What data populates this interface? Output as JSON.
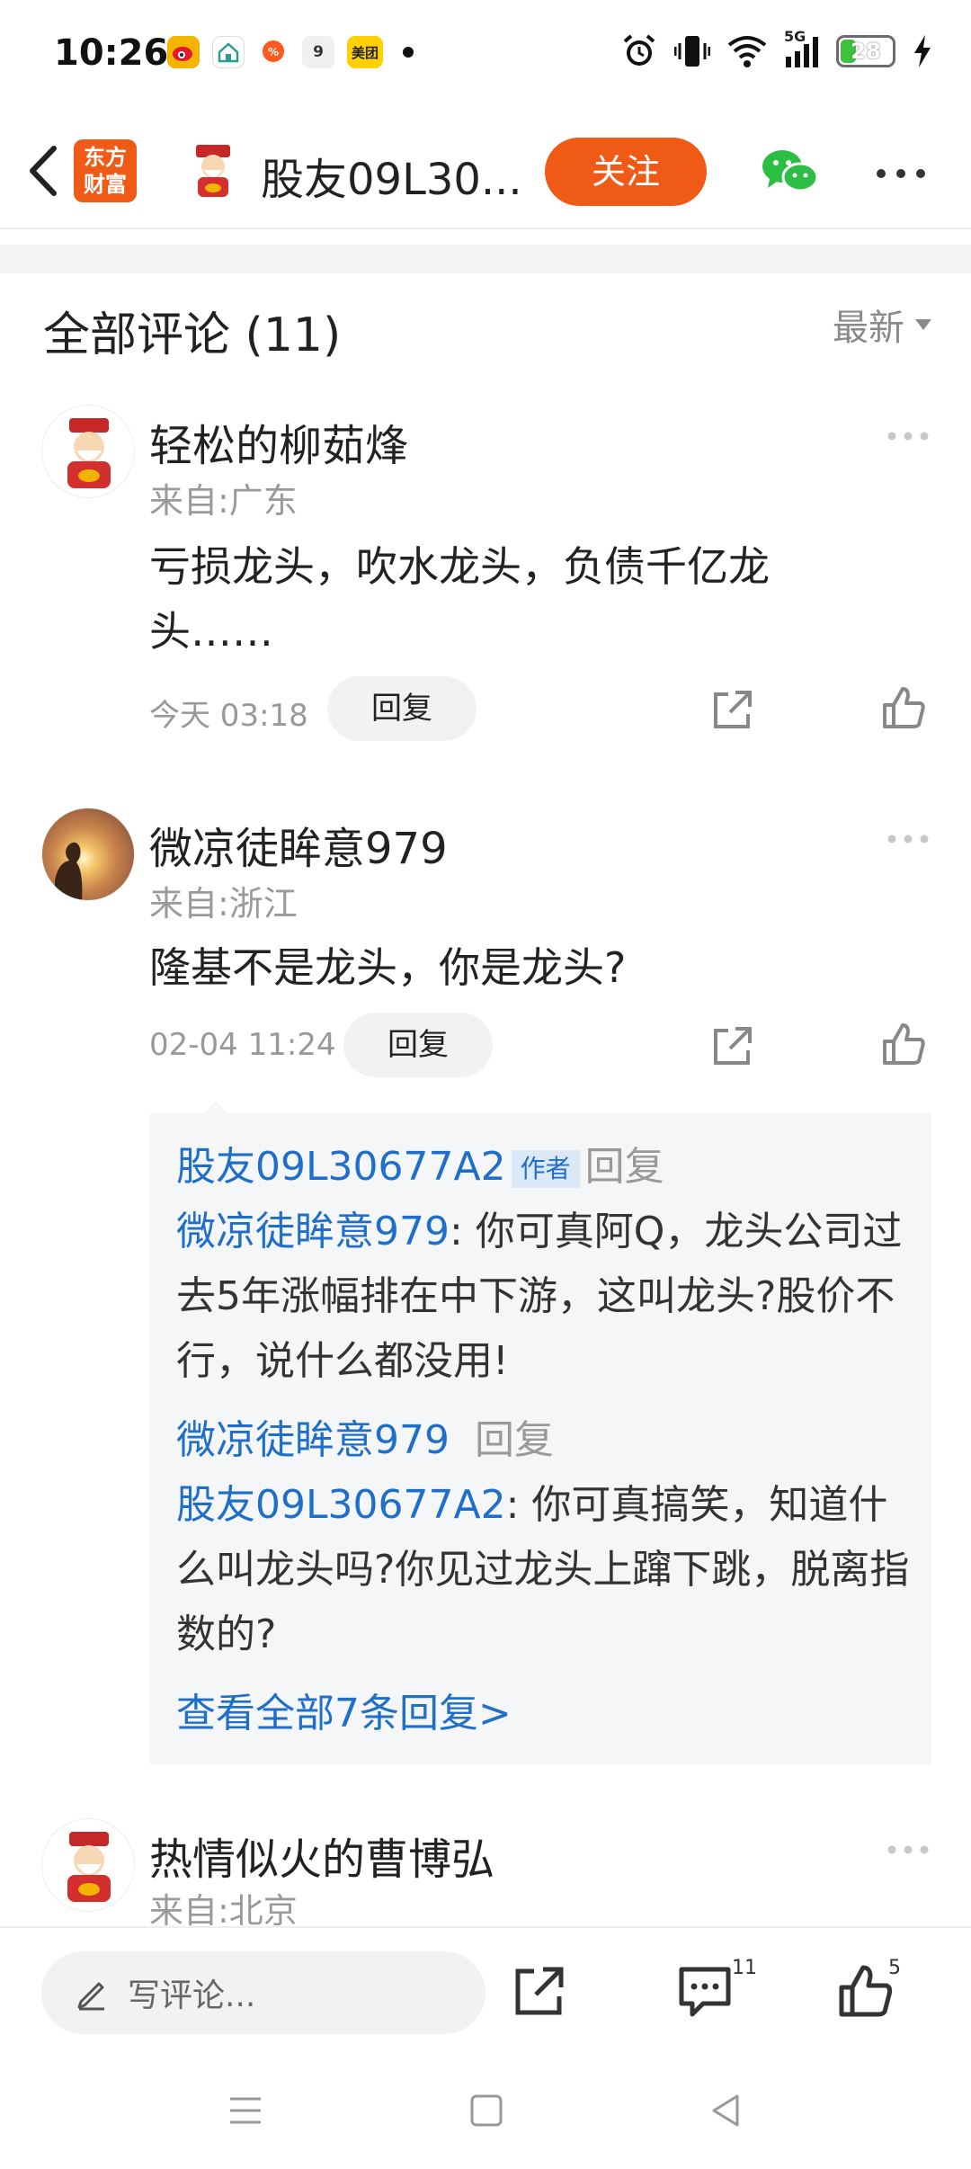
{
  "status_bar": {
    "time": "10:26",
    "apps": [
      {
        "icon": "weibo-icon",
        "label": "",
        "color": "#f4b400"
      },
      {
        "icon": "home-app-icon",
        "label": "",
        "color": "#ffffff"
      },
      {
        "icon": "taobao-deal-icon",
        "label": "",
        "color": "#ff5a1f"
      },
      {
        "icon": "nine-app-icon",
        "label": "9",
        "color": "#f0f0f0"
      },
      {
        "icon": "meituan-icon",
        "label": "美团",
        "color": "#ffd100"
      }
    ],
    "network": "5G",
    "battery": "28",
    "battery_level": 0.28
  },
  "header": {
    "brand": "东方财富",
    "title": "股友09L30...",
    "follow_label": "关注"
  },
  "comments_header": {
    "title": "全部评论 (11)",
    "sort_label": "最新"
  },
  "comments": [
    {
      "name": "轻松的柳茹烽",
      "location": "来自:广东",
      "text": "亏损龙头，吹水龙头，负债千亿龙头……",
      "time": "今天 03:18",
      "reply_label": "回复"
    },
    {
      "name": "微凉徒眸意979",
      "location": "来自:浙江",
      "text": "隆基不是龙头，你是龙头?",
      "time": "02-04 11:24",
      "reply_label": "回复",
      "replies": [
        {
          "author": "股友09L30677A2",
          "author_tag": "作者",
          "reply_word": "回复",
          "target": "微凉徒眸意979",
          "text": ": 你可真阿Q，龙头公司过去5年涨幅排在中下游，这叫龙头?股价不行，说什么都没用!"
        },
        {
          "author": "微凉徒眸意979",
          "reply_word": "回复",
          "target": "股友09L30677A2",
          "text": ": 你可真搞笑，知道什么叫龙头吗?你见过龙头上蹿下跳，脱离指数的?"
        }
      ],
      "view_all": "查看全部7条回复>"
    },
    {
      "name": "热情似火的曹博弘",
      "location": "来自:北京"
    }
  ],
  "bottom_bar": {
    "comment_placeholder": "写评论...",
    "comment_count": "11",
    "like_count": "5"
  },
  "colors": {
    "accent": "#ef5a16",
    "link_blue": "#1f6ec9",
    "wechat_green": "#2dbe44"
  }
}
